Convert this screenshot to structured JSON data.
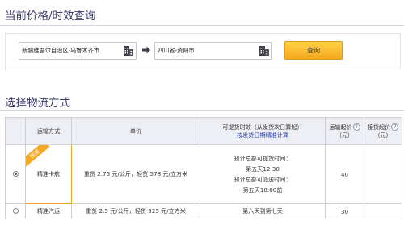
{
  "query_section": {
    "title": "当前价格/时效查询",
    "origin": "新疆维吾尔自治区-乌鲁木齐市",
    "destination": "四川省-资阳市",
    "query_label": "查询"
  },
  "shipping_section": {
    "title": "选择物流方式",
    "headers": {
      "method": "运输方式",
      "price": "单价",
      "time_line1": "可提货时效（从发货次日算起）",
      "time_line2": "按发货日期精准计算",
      "min_weight": "运输起价",
      "min_weight_unit": "（元）",
      "pickup_fee": "接货起价",
      "pickup_fee_unit": "（元）"
    },
    "rows": [
      {
        "selected": true,
        "badge": "快递",
        "method": "精准卡航",
        "price": "重货 2.75 元/公斤，轻货 578 元/立方米",
        "time_lines": [
          "预计总部可提货时间：",
          "第五天12:30",
          "预计总部可派送时间：",
          "第五天18:00前"
        ],
        "min_price": "40",
        "pickup_price": ""
      },
      {
        "selected": false,
        "badge": "",
        "method": "精准汽运",
        "price": "重货 2.5 元/公斤，轻货 525 元/立方米",
        "time_lines": [
          "第六天到第七天"
        ],
        "min_price": "30",
        "pickup_price": ""
      }
    ]
  },
  "colors": {
    "accent": "#f4a823",
    "title": "#3a3a6a",
    "link": "#2a3fa8"
  },
  "icons": {
    "origin_picker": "building-icon",
    "destination_picker": "building-icon",
    "direction": "arrow-right-icon"
  }
}
